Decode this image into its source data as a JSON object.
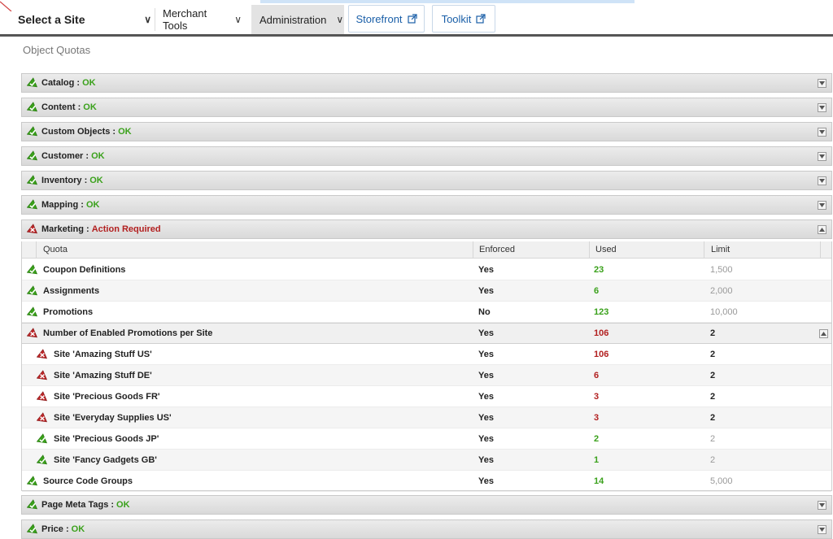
{
  "nav": {
    "site_select": "Select a Site",
    "merchant_tools": "Merchant Tools",
    "administration": "Administration",
    "storefront": "Storefront",
    "toolkit": "Toolkit"
  },
  "page_title": "Object Quotas",
  "sections_top": [
    {
      "name": "Catalog :",
      "status": "OK",
      "state": "ok"
    },
    {
      "name": "Content :",
      "status": "OK",
      "state": "ok"
    },
    {
      "name": "Custom Objects :",
      "status": "OK",
      "state": "ok"
    },
    {
      "name": "Customer :",
      "status": "OK",
      "state": "ok"
    },
    {
      "name": "Inventory :",
      "status": "OK",
      "state": "ok"
    },
    {
      "name": "Mapping :",
      "status": "OK",
      "state": "ok"
    },
    {
      "name": "Marketing :",
      "status": "Action Required",
      "state": "error"
    }
  ],
  "table": {
    "headers": {
      "quota": "Quota",
      "enforced": "Enforced",
      "used": "Used",
      "limit": "Limit"
    },
    "rows": [
      {
        "name": "Coupon Definitions",
        "enforced": "Yes",
        "used": "23",
        "limit": "1,500",
        "state": "ok",
        "indent": 0
      },
      {
        "name": "Assignments",
        "enforced": "Yes",
        "used": "6",
        "limit": "2,000",
        "state": "ok",
        "indent": 0
      },
      {
        "name": "Promotions",
        "enforced": "No",
        "used": "123",
        "limit": "10,000",
        "state": "ok",
        "indent": 0
      },
      {
        "name": "Number of Enabled Promotions per Site",
        "enforced": "Yes",
        "used": "106",
        "limit": "2",
        "state": "error",
        "indent": 0,
        "group": true
      },
      {
        "name": "Site 'Amazing Stuff US'",
        "enforced": "Yes",
        "used": "106",
        "limit": "2",
        "state": "error",
        "indent": 1
      },
      {
        "name": "Site 'Amazing Stuff DE'",
        "enforced": "Yes",
        "used": "6",
        "limit": "2",
        "state": "error",
        "indent": 1
      },
      {
        "name": "Site 'Precious Goods FR'",
        "enforced": "Yes",
        "used": "3",
        "limit": "2",
        "state": "error",
        "indent": 1
      },
      {
        "name": "Site 'Everyday Supplies US'",
        "enforced": "Yes",
        "used": "3",
        "limit": "2",
        "state": "error",
        "indent": 1
      },
      {
        "name": "Site 'Precious Goods JP'",
        "enforced": "Yes",
        "used": "2",
        "limit": "2",
        "state": "ok",
        "indent": 1
      },
      {
        "name": "Site 'Fancy Gadgets GB'",
        "enforced": "Yes",
        "used": "1",
        "limit": "2",
        "state": "ok",
        "indent": 1
      },
      {
        "name": "Source Code Groups",
        "enforced": "Yes",
        "used": "14",
        "limit": "5,000",
        "state": "ok",
        "indent": 0
      }
    ]
  },
  "sections_bottom": [
    {
      "name": "Page Meta Tags :",
      "status": "OK",
      "state": "ok"
    },
    {
      "name": "Price :",
      "status": "OK",
      "state": "ok"
    }
  ],
  "colors": {
    "ok": "#3aa11b",
    "error": "#b22020"
  }
}
